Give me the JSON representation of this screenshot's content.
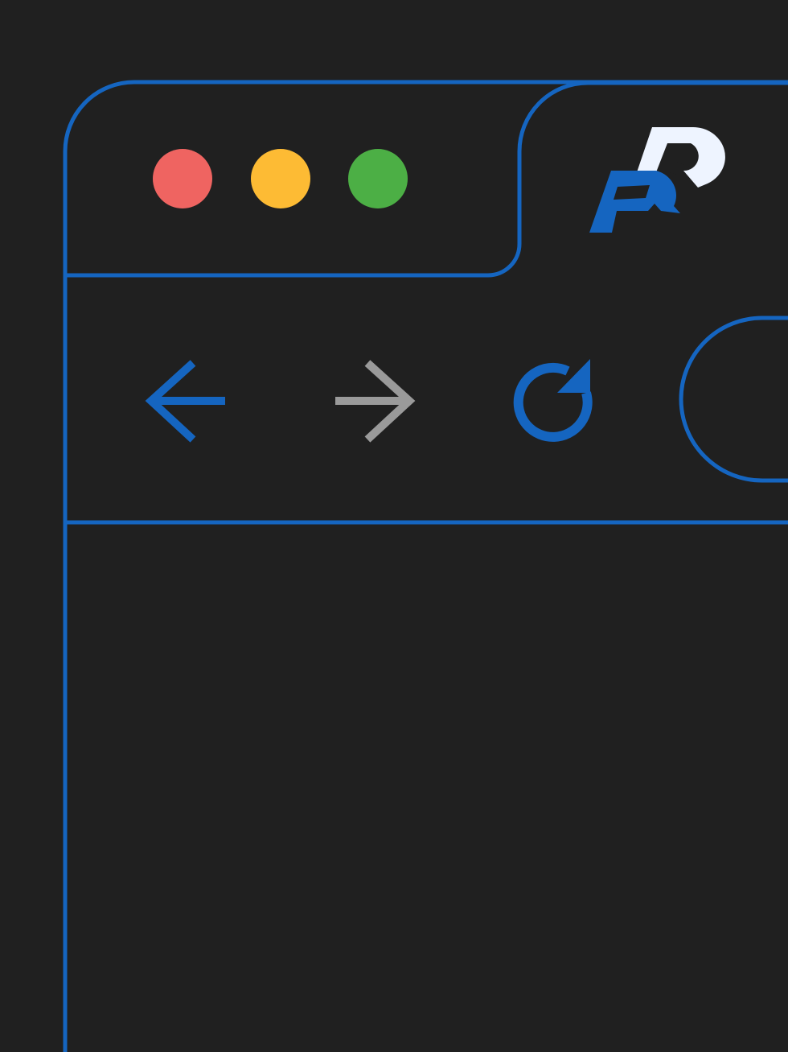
{
  "theme": {
    "background": "#202020",
    "outline": "#1565C0",
    "accent": "#1565C0",
    "muted_icon": "#9A9A9A",
    "logo_light": "#EEF4FF"
  },
  "window_controls": {
    "close": {
      "icon": "close-dot",
      "color": "#EF6461"
    },
    "minimize": {
      "icon": "minimize-dot",
      "color": "#FDBB34"
    },
    "maximize": {
      "icon": "maximize-dot",
      "color": "#4CAF45"
    }
  },
  "tab": {
    "icon": "brand-logo-icon"
  },
  "toolbar": {
    "back": {
      "icon": "arrow-left-icon",
      "enabled": true
    },
    "forward": {
      "icon": "arrow-right-icon",
      "enabled": false
    },
    "reload": {
      "icon": "reload-icon"
    }
  },
  "address_bar": {
    "value": ""
  }
}
